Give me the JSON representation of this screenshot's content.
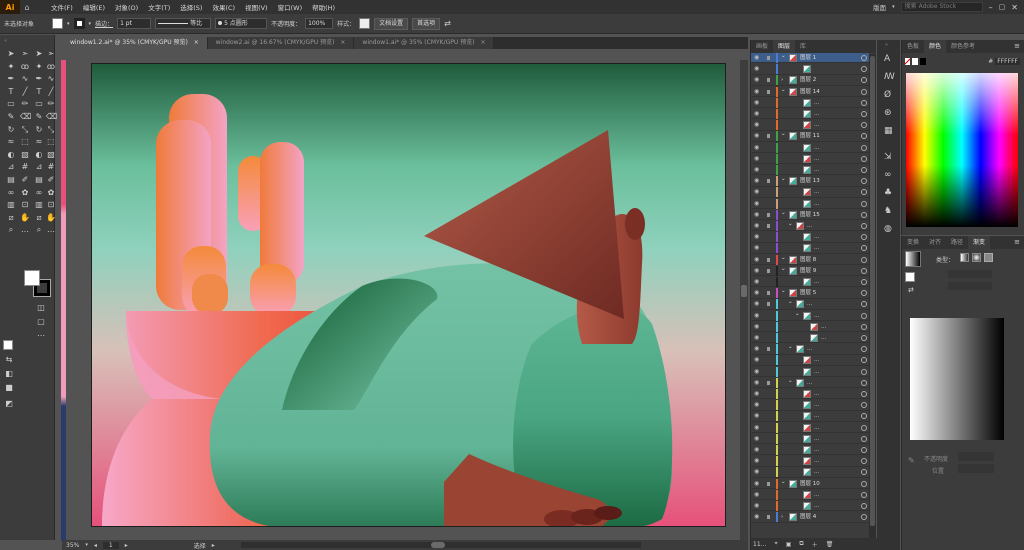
{
  "app": {
    "logo": "Ai"
  },
  "menu": [
    "文件(F)",
    "编辑(E)",
    "对象(O)",
    "文字(T)",
    "选择(S)",
    "效果(C)",
    "视图(V)",
    "窗口(W)",
    "帮助(H)"
  ],
  "menubar_right": {
    "workspace": "版面",
    "search_placeholder": "搜索 Adobe Stock"
  },
  "control_bar": {
    "selection": "未选择对象",
    "stroke_label": "描边：",
    "stroke_value": "1 pt",
    "stroke_style": "等比",
    "brush": "5 点圆形",
    "opacity_label": "不透明度：",
    "opacity_value": "100%",
    "style_label": "样式：",
    "doc_setup": "文档设置",
    "preferences": "首选项"
  },
  "tabs": [
    "window1.2.ai* @ 35% (CMYK/GPU 预览)",
    "window2.ai @ 16.67% (CMYK/GPU 预览)",
    "window1.ai* @ 35% (CMYK/GPU 预览)"
  ],
  "status": {
    "zoom": "35%",
    "page": "1",
    "mode": "选择"
  },
  "layers_panel": {
    "tabs": [
      "画板",
      "图层",
      "库"
    ],
    "active_tab": "图层",
    "rows": [
      {
        "name": "图层 1",
        "color": "#4f7bd8",
        "indent": 0,
        "expanded": true,
        "selected": true
      },
      {
        "name": "",
        "color": "#4f7bd8",
        "indent": 2
      },
      {
        "name": "图层 2",
        "color": "#3fa24a",
        "indent": 0
      },
      {
        "name": "图层 14",
        "color": "#e06b2a",
        "indent": 0,
        "expanded": true
      },
      {
        "name": "...",
        "color": "#e06b2a",
        "indent": 2
      },
      {
        "name": "...",
        "color": "#e06b2a",
        "indent": 2
      },
      {
        "name": "...",
        "color": "#e06b2a",
        "indent": 2
      },
      {
        "name": "图层 11",
        "color": "#3fa24a",
        "indent": 0,
        "expanded": true
      },
      {
        "name": "...",
        "color": "#3fa24a",
        "indent": 2
      },
      {
        "name": "...",
        "color": "#3fa24a",
        "indent": 2
      },
      {
        "name": "...",
        "color": "#3fa24a",
        "indent": 2
      },
      {
        "name": "图层 13",
        "color": "#c9a27a",
        "indent": 0,
        "expanded": true
      },
      {
        "name": "...",
        "color": "#c9a27a",
        "indent": 2
      },
      {
        "name": "...",
        "color": "#c9a27a",
        "indent": 2
      },
      {
        "name": "图层 15",
        "color": "#8a4fcf",
        "indent": 0,
        "expanded": true
      },
      {
        "name": "...",
        "color": "#8a4fcf",
        "indent": 1,
        "expanded": true
      },
      {
        "name": "...",
        "color": "#8a4fcf",
        "indent": 2
      },
      {
        "name": "...",
        "color": "#8a4fcf",
        "indent": 2
      },
      {
        "name": "图层 8",
        "color": "#e04a4a",
        "indent": 0,
        "expanded": true
      },
      {
        "name": "图层 9",
        "color": "#222222",
        "indent": 0,
        "expanded": true
      },
      {
        "name": "...",
        "color": "#222222",
        "indent": 2
      },
      {
        "name": "图层 5",
        "color": "#c94fc0",
        "indent": 0,
        "expanded": true
      },
      {
        "name": "...",
        "color": "#4fc9d6",
        "indent": 1,
        "expanded": true
      },
      {
        "name": "...",
        "color": "#4fc9d6",
        "indent": 2,
        "expanded": true
      },
      {
        "name": "...",
        "color": "#4fc9d6",
        "indent": 3
      },
      {
        "name": "...",
        "color": "#4fc9d6",
        "indent": 3
      },
      {
        "name": "...",
        "color": "#4fc9d6",
        "indent": 1,
        "expanded": true
      },
      {
        "name": "...",
        "color": "#4fc9d6",
        "indent": 2
      },
      {
        "name": "...",
        "color": "#4fc9d6",
        "indent": 2
      },
      {
        "name": "...",
        "color": "#d6d04f",
        "indent": 1,
        "expanded": true
      },
      {
        "name": "...",
        "color": "#d6d04f",
        "indent": 2
      },
      {
        "name": "...",
        "color": "#d6d04f",
        "indent": 2
      },
      {
        "name": "...",
        "color": "#d6d04f",
        "indent": 2
      },
      {
        "name": "...",
        "color": "#d6d04f",
        "indent": 2
      },
      {
        "name": "...",
        "color": "#d6d04f",
        "indent": 2
      },
      {
        "name": "...",
        "color": "#d6d04f",
        "indent": 2
      },
      {
        "name": "...",
        "color": "#d6d04f",
        "indent": 2
      },
      {
        "name": "...",
        "color": "#d6d04f",
        "indent": 2
      },
      {
        "name": "图层 10",
        "color": "#e06b2a",
        "indent": 0,
        "expanded": true
      },
      {
        "name": "...",
        "color": "#e06b2a",
        "indent": 2
      },
      {
        "name": "...",
        "color": "#e06b2a",
        "indent": 2
      },
      {
        "name": "图层 4",
        "color": "#4f7bd8",
        "indent": 0
      }
    ],
    "footer": "11..."
  },
  "color_panel": {
    "tabs": [
      "色板",
      "颜色",
      "颜色参考"
    ],
    "active_tab": "颜色",
    "hex": "FFFFFF"
  },
  "gradient_panel": {
    "tabs": [
      "变换",
      "对齐",
      "路径",
      "渐变"
    ],
    "active_tab": "渐变",
    "type_label": "类型：",
    "opacity_label": "不透明度",
    "position_label": "位置"
  }
}
